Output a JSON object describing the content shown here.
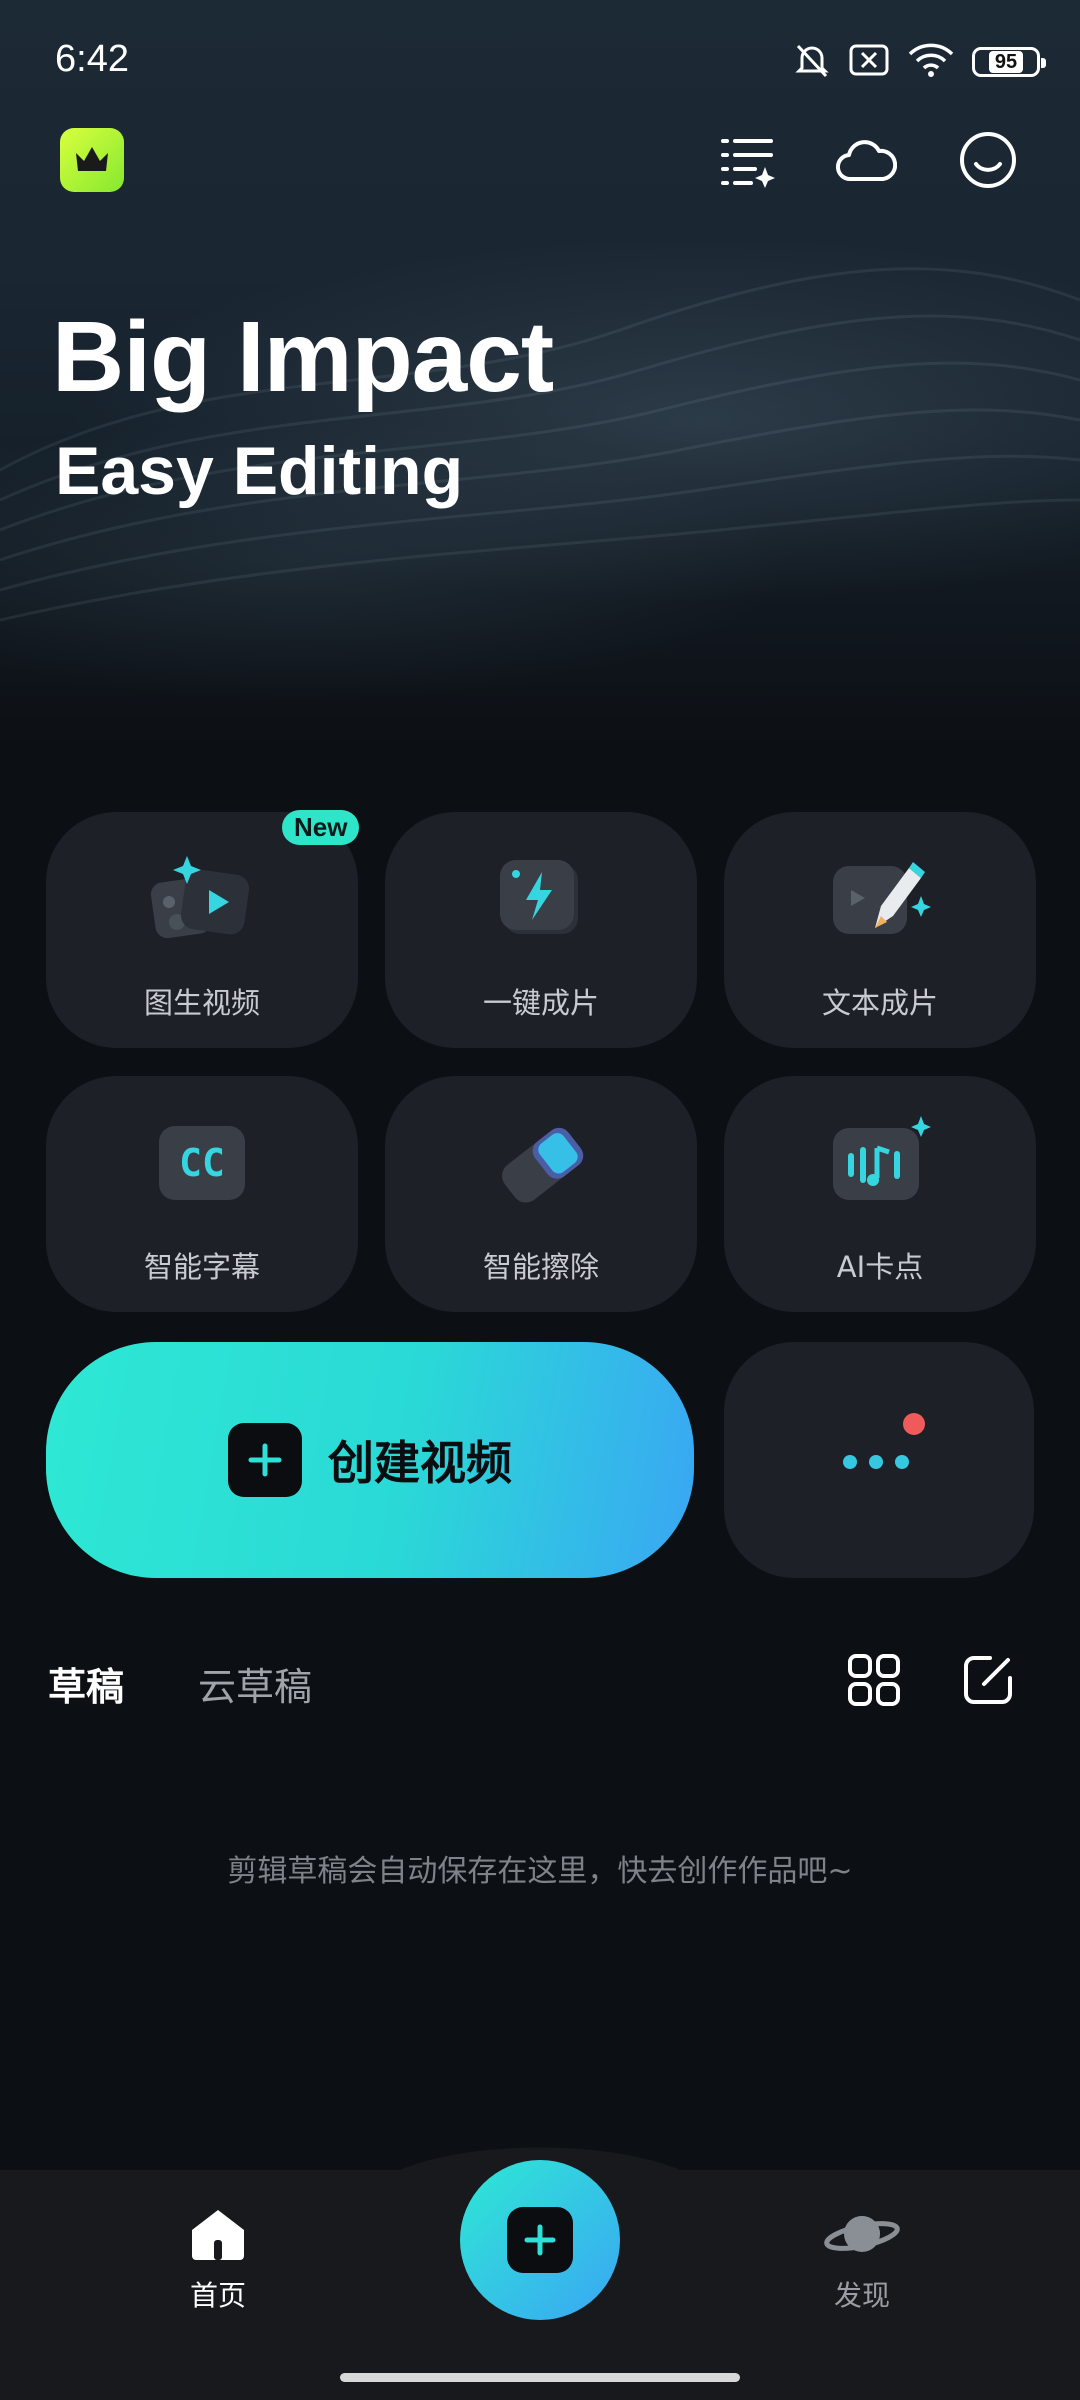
{
  "status_bar": {
    "time": "6:42",
    "battery": "95"
  },
  "hero": {
    "title": "Big Impact",
    "subtitle": "Easy Editing"
  },
  "tools": [
    {
      "label": "图生视频",
      "icon": "image-to-video-icon",
      "badge": "New"
    },
    {
      "label": "一键成片",
      "icon": "lightning-icon"
    },
    {
      "label": "文本成片",
      "icon": "text-to-video-icon"
    },
    {
      "label": "智能字幕",
      "icon": "cc-icon"
    },
    {
      "label": "智能擦除",
      "icon": "eraser-icon"
    },
    {
      "label": "AI卡点",
      "icon": "music-beat-icon"
    }
  ],
  "create": {
    "label": "创建视频"
  },
  "drafts": {
    "tabs": [
      "草稿",
      "云草稿"
    ],
    "empty_text": "剪辑草稿会自动保存在这里，快去创作作品吧~"
  },
  "bottom_nav": {
    "home": "首页",
    "discover": "发现"
  },
  "colors": {
    "accent_start": "#2ee8d4",
    "accent_end": "#3aa6f4",
    "badge": "#2fe5c9",
    "notify_dot": "#f05a5a",
    "tile_bg": "#1d2026"
  }
}
